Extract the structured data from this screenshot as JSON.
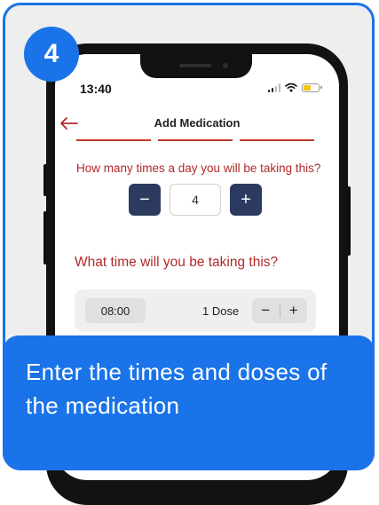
{
  "step": {
    "number": "4"
  },
  "status_bar": {
    "time": "13:40"
  },
  "header": {
    "title": "Add Medication",
    "back_icon": "arrow-left-icon"
  },
  "colors": {
    "accent": "#1a73e8",
    "brand_red": "#b02a2a",
    "stepper_bg": "#2b3a5e"
  },
  "frequency": {
    "question": "How many times a day you will be taking this?",
    "decrement_label": "−",
    "value": "4",
    "increment_label": "+"
  },
  "schedule": {
    "question": "What time will you be taking this?",
    "rows": [
      {
        "time": "08:00",
        "dose": "1 Dose",
        "minus": "−",
        "plus": "+"
      }
    ]
  },
  "caption": {
    "text": "Enter the times and doses of the medication"
  }
}
